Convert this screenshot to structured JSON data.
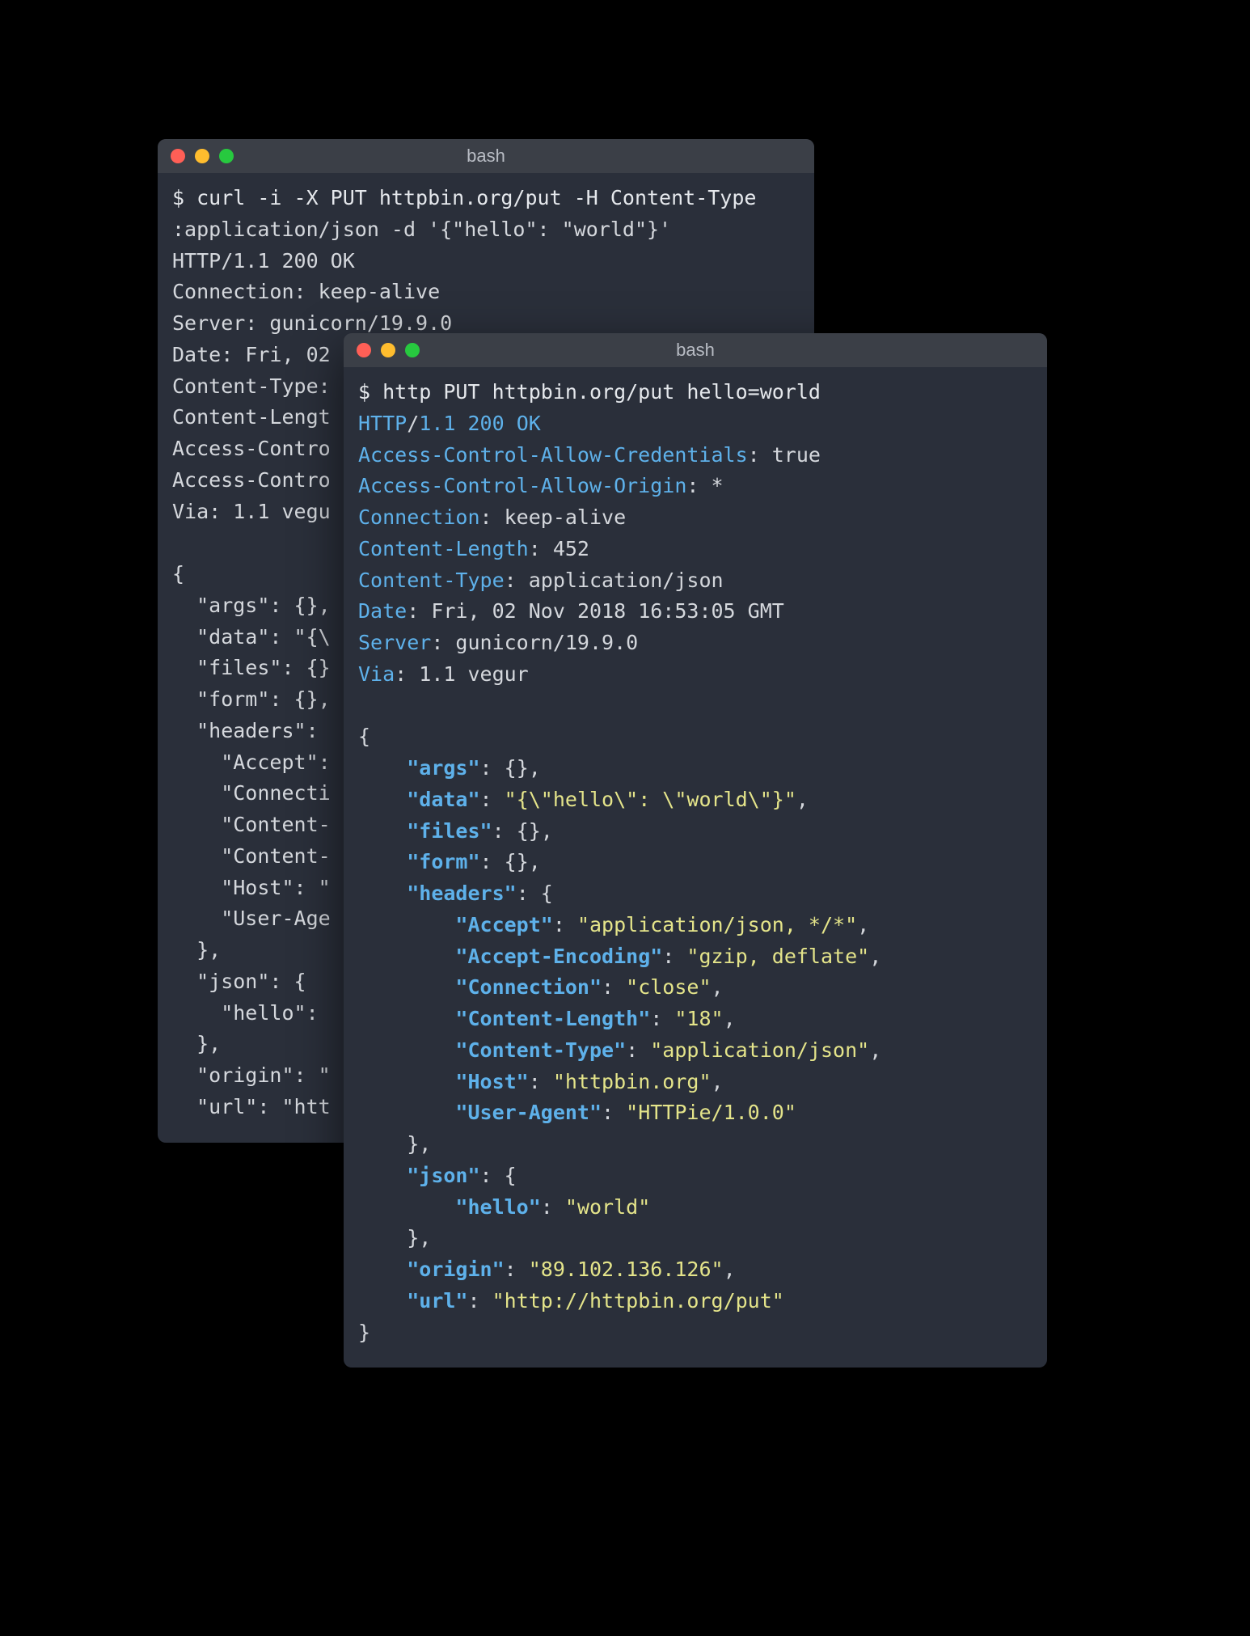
{
  "back_terminal": {
    "title": "bash",
    "lines": {
      "l1": "$ curl -i -X PUT httpbin.org/put -H Content-Type",
      "l2": ":application/json -d '{\"hello\": \"world\"}'",
      "l3": "HTTP/1.1 200 OK",
      "l4": "Connection: keep-alive",
      "l5": "Server: gunicorn/19.9.0",
      "l6": "Date: Fri, 02 ",
      "l7": "Content-Type: ",
      "l8": "Content-Lengt",
      "l9": "Access-Contro",
      "l10": "Access-Contro",
      "l11": "Via: 1.1 vegu",
      "l12": "",
      "l13": "{",
      "l14": "  \"args\": {},",
      "l15": "  \"data\": \"{\\",
      "l16": "  \"files\": {}",
      "l17": "  \"form\": {},",
      "l18": "  \"headers\": ",
      "l19": "    \"Accept\":",
      "l20": "    \"Connecti",
      "l21": "    \"Content-",
      "l22": "    \"Content-",
      "l23": "    \"Host\": \"",
      "l24": "    \"User-Age",
      "l25": "  },",
      "l26": "  \"json\": {",
      "l27": "    \"hello\": ",
      "l28": "  },",
      "l29": "  \"origin\": \"",
      "l30": "  \"url\": \"htt"
    }
  },
  "front_terminal": {
    "title": "bash",
    "cmd": "$ http PUT httpbin.org/put hello=world",
    "status_line": {
      "http": "HTTP",
      "slash": "/",
      "ver": "1.1",
      "sp": " ",
      "code": "200",
      "sp2": " ",
      "ok": "OK"
    },
    "headers": [
      {
        "k": "Access-Control-Allow-Credentials",
        "v": "true"
      },
      {
        "k": "Access-Control-Allow-Origin",
        "v": "*"
      },
      {
        "k": "Connection",
        "v": "keep-alive"
      },
      {
        "k": "Content-Length",
        "v": "452"
      },
      {
        "k": "Content-Type",
        "v": "application/json"
      },
      {
        "k": "Date",
        "v": "Fri, 02 Nov 2018 16:53:05 GMT"
      },
      {
        "k": "Server",
        "v": "gunicorn/19.9.0"
      },
      {
        "k": "Via",
        "v": "1.1 vegur"
      }
    ],
    "body": {
      "open": "{",
      "args_k": "\"args\"",
      "args_v": "{}",
      "data_k": "\"data\"",
      "data_v": "\"{\\\"hello\\\": \\\"world\\\"}\"",
      "files_k": "\"files\"",
      "files_v": "{}",
      "form_k": "\"form\"",
      "form_v": "{}",
      "headers_k": "\"headers\"",
      "headers_open": "{",
      "accept_k": "\"Accept\"",
      "accept_v": "\"application/json, */*\"",
      "ae_k": "\"Accept-Encoding\"",
      "ae_v": "\"gzip, deflate\"",
      "conn_k": "\"Connection\"",
      "conn_v": "\"close\"",
      "cl_k": "\"Content-Length\"",
      "cl_v": "\"18\"",
      "ct_k": "\"Content-Type\"",
      "ct_v": "\"application/json\"",
      "host_k": "\"Host\"",
      "host_v": "\"httpbin.org\"",
      "ua_k": "\"User-Agent\"",
      "ua_v": "\"HTTPie/1.0.0\"",
      "headers_close": "}",
      "json_k": "\"json\"",
      "json_open": "{",
      "hello_k": "\"hello\"",
      "hello_v": "\"world\"",
      "json_close": "}",
      "origin_k": "\"origin\"",
      "origin_v": "\"89.102.136.126\"",
      "url_k": "\"url\"",
      "url_v": "\"http://httpbin.org/put\"",
      "close": "}"
    }
  }
}
